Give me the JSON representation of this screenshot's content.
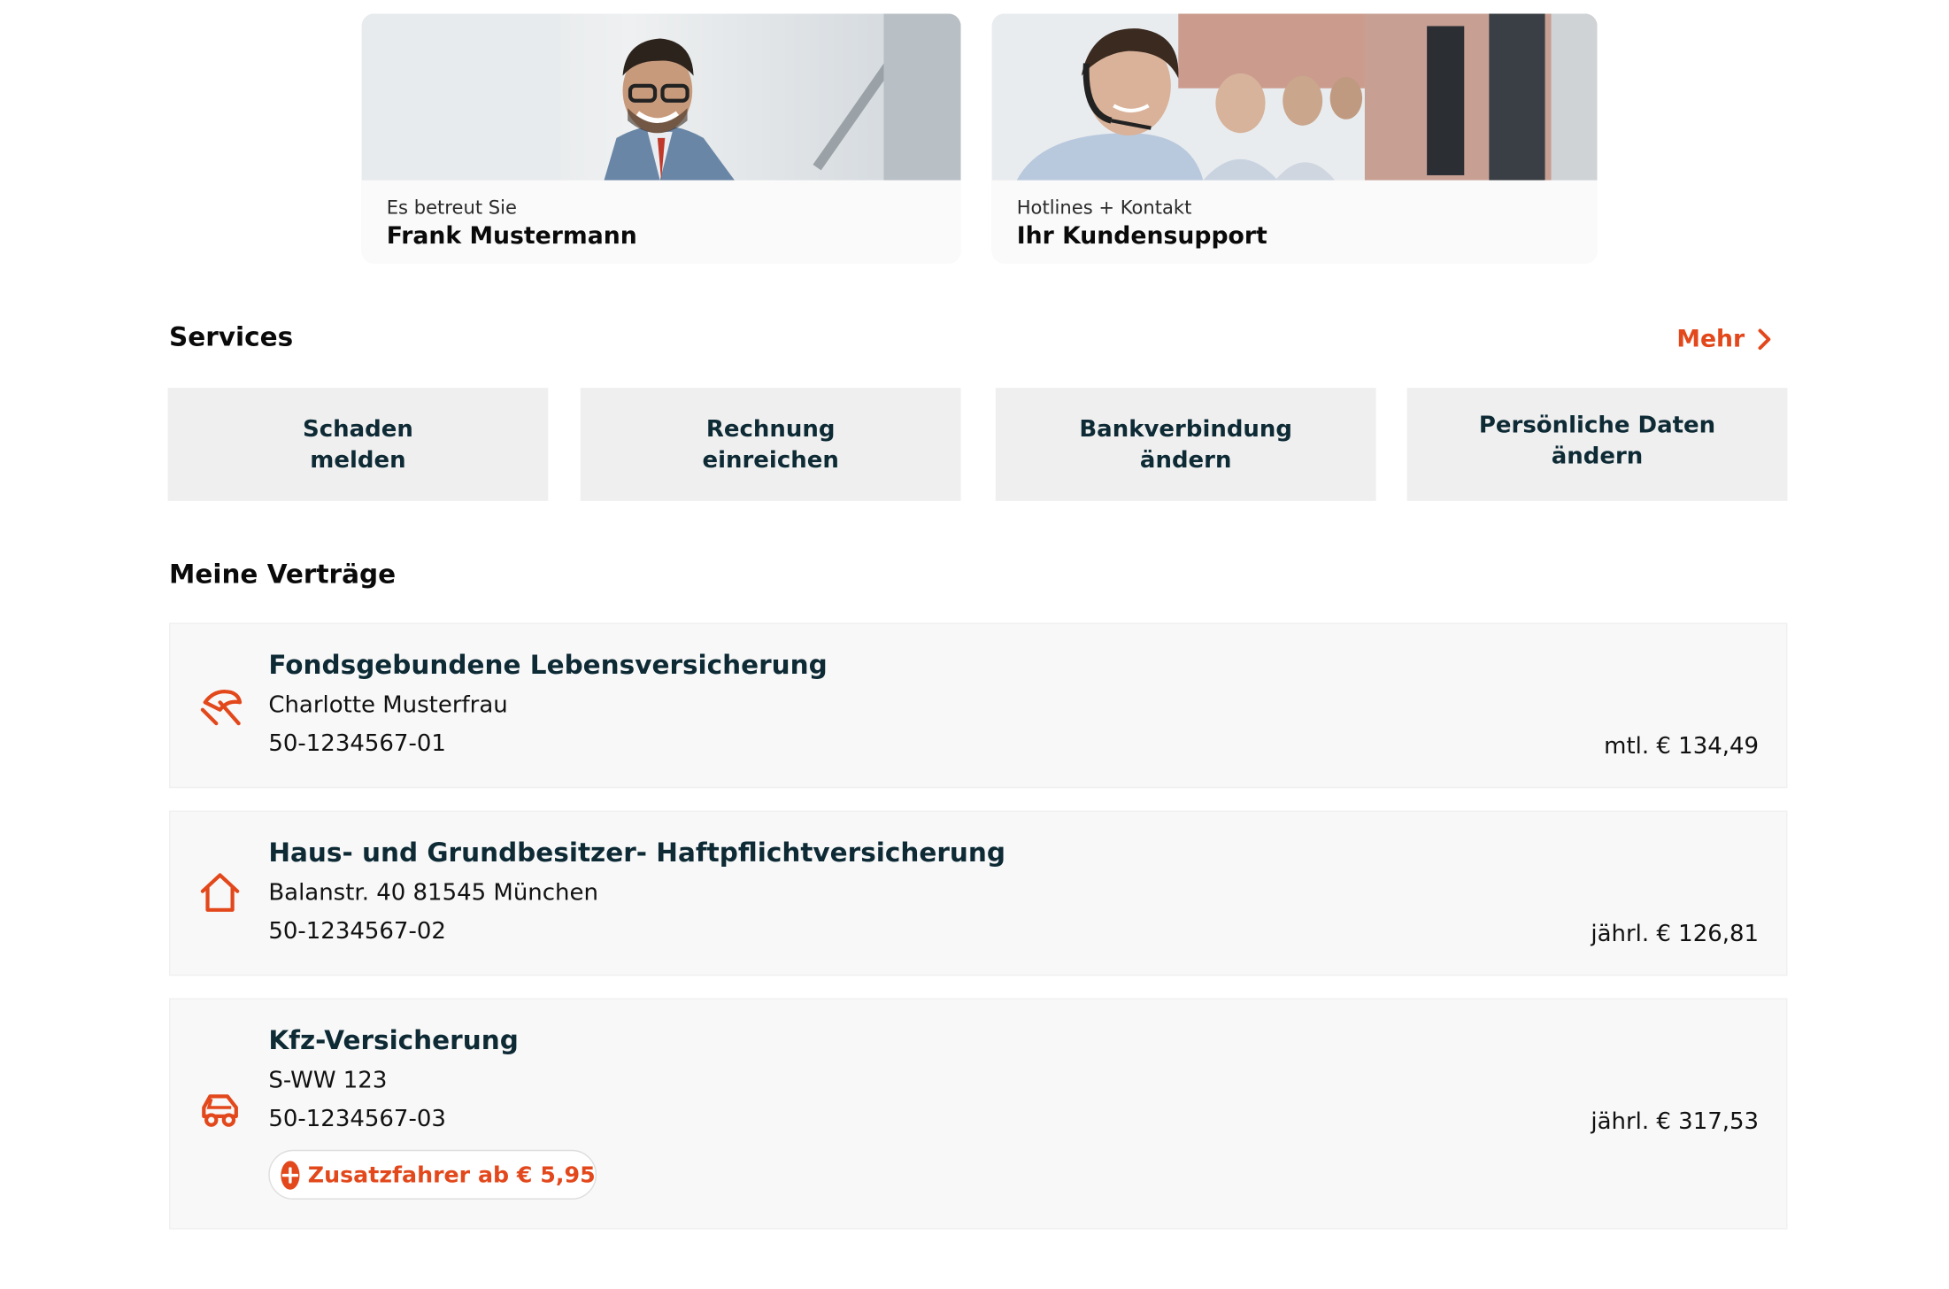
{
  "advisor_card": {
    "kicker": "Es betreut Sie",
    "name": "Frank Mustermann"
  },
  "support_card": {
    "kicker": "Hotlines + Kontakt",
    "title": "Ihr Kundensupport"
  },
  "services": {
    "title": "Services",
    "more_label": "Mehr",
    "items": [
      {
        "label": "Schaden\nmelden"
      },
      {
        "label": "Rechnung\neinreichen"
      },
      {
        "label": "Bankverbindung\nändern"
      },
      {
        "label": "Persönliche Daten\nändern"
      }
    ]
  },
  "contracts": {
    "title": "Meine Verträge",
    "items": [
      {
        "icon": "umbrella-icon",
        "title": "Fondsgebundene Lebensversicherung",
        "subtitle": "Charlotte Musterfrau",
        "number": "50-1234567-01",
        "price": "mtl. € 134,49"
      },
      {
        "icon": "house-icon",
        "title": "Haus- und Grundbesitzer- Haftpflichtversicherung",
        "subtitle": "Balanstr. 40 81545 München",
        "number": "50-1234567-02",
        "price": "jährl. € 126,81"
      },
      {
        "icon": "car-icon",
        "title": "Kfz-Versicherung",
        "subtitle": "S-WW 123",
        "number": "50-1234567-03",
        "price": "jährl. € 317,53",
        "addon": "Zusatzfahrer ab € 5,95"
      }
    ]
  },
  "colors": {
    "accent": "#e2481b",
    "tile_bg": "#efefef",
    "card_bg": "#f8f8f8",
    "heading": "#0d2a35"
  }
}
